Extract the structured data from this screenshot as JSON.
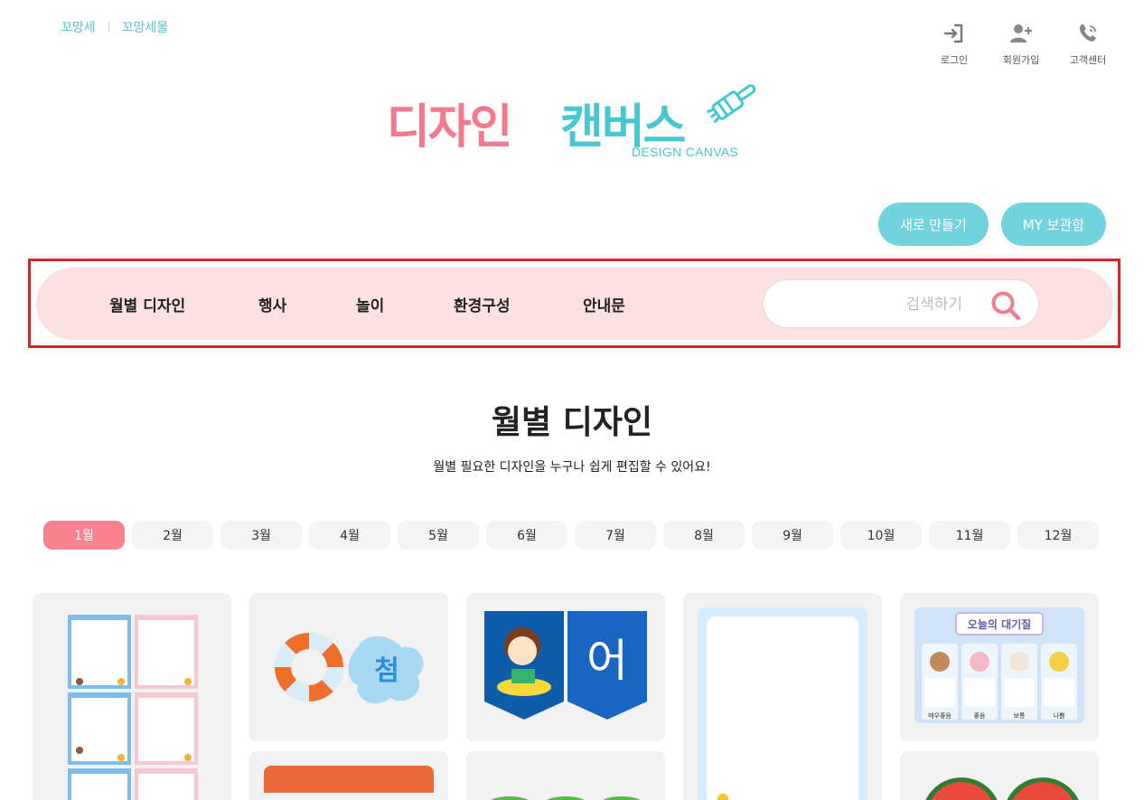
{
  "top_links": [
    "꼬망세",
    "꼬망세몰"
  ],
  "utility": [
    {
      "label": "로그인",
      "icon": "login-icon"
    },
    {
      "label": "회원가입",
      "icon": "add-user-icon"
    },
    {
      "label": "고객센터",
      "icon": "phone-icon"
    }
  ],
  "logo": {
    "part1": "디자인",
    "part2": "캔버스",
    "sub": "DESIGN CANVAS",
    "color_pink": "#f4798d",
    "color_teal": "#45c8cf"
  },
  "actions": {
    "new_label": "새로 만들기",
    "my_label": "MY 보관함"
  },
  "nav": {
    "items": [
      "월별 디자인",
      "행사",
      "놀이",
      "환경구성",
      "안내문"
    ],
    "search_placeholder": "검색하기"
  },
  "section": {
    "title": "월별 디자인",
    "description": "월별 필요한 디자인을 누구나 쉽게 편집할 수 있어요!"
  },
  "months": [
    "1월",
    "2월",
    "3월",
    "4월",
    "5월",
    "6월",
    "7월",
    "8월",
    "9월",
    "10월",
    "11월",
    "12월"
  ],
  "active_month": "1월",
  "cards": {
    "tube_text": "첨",
    "banner_text": "어",
    "board_title": "오늘의 대기질",
    "board_labels": [
      "매우좋음",
      "좋음",
      "보통",
      "나쁨"
    ]
  },
  "colors": {
    "accent_pink": "#f8828f",
    "accent_teal": "#72d3df",
    "nav_bg": "#fde0e2"
  }
}
